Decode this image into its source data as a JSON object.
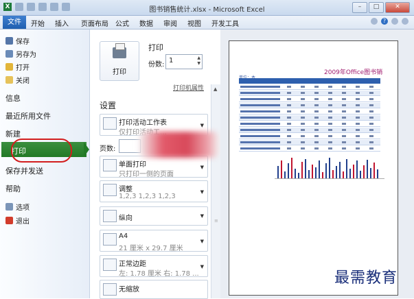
{
  "window": {
    "title": "图书销售统计.xlsx - Microsoft Excel",
    "logo_text": "X"
  },
  "ribbon": {
    "tabs": [
      "文件",
      "开始",
      "插入",
      "页面布局",
      "公式",
      "数据",
      "审阅",
      "视图",
      "开发工具"
    ]
  },
  "sidebar": {
    "top_items": [
      "保存",
      "另存为",
      "打开",
      "关闭"
    ],
    "sections": [
      "信息",
      "最近所用文件",
      "新建",
      "打印",
      "保存并发送",
      "帮助"
    ],
    "bottom_items": [
      "选项",
      "退出"
    ],
    "selected": "打印"
  },
  "print_panel": {
    "heading": "打印",
    "button_label": "打印",
    "copies_label": "份数:",
    "copies_value": "1",
    "printer_properties": "打印机属性",
    "settings_heading": "设置",
    "pages_label": "页数:",
    "dropdowns": [
      {
        "line1": "打印活动工作表",
        "line2": "仅打印活动工..."
      },
      {
        "line1": "单面打印",
        "line2": "只打印一侧的页面"
      },
      {
        "line1": "调整",
        "line2": "1,2,3   1,2,3   1,2,3"
      },
      {
        "line1": "纵向",
        "line2": ""
      },
      {
        "line1": "A4",
        "line2": "21 厘米 x 29.7 厘米"
      },
      {
        "line1": "正常边距",
        "line2": "左: 1.78 厘米   右: 1.78 ..."
      },
      {
        "line1": "无缩放",
        "line2": ""
      }
    ]
  },
  "preview": {
    "report_title": "2009年Office图书销",
    "unit_label": "单位：本"
  },
  "watermark": "最需教育",
  "colors": {
    "file_tab": "#2a6bc0",
    "print_highlight": "#2e8a32",
    "annotation_oval": "#d21d1d",
    "table_header": "#2d5fae",
    "chart_bar_red": "#c0142e",
    "chart_bar_blue": "#203f8c"
  }
}
